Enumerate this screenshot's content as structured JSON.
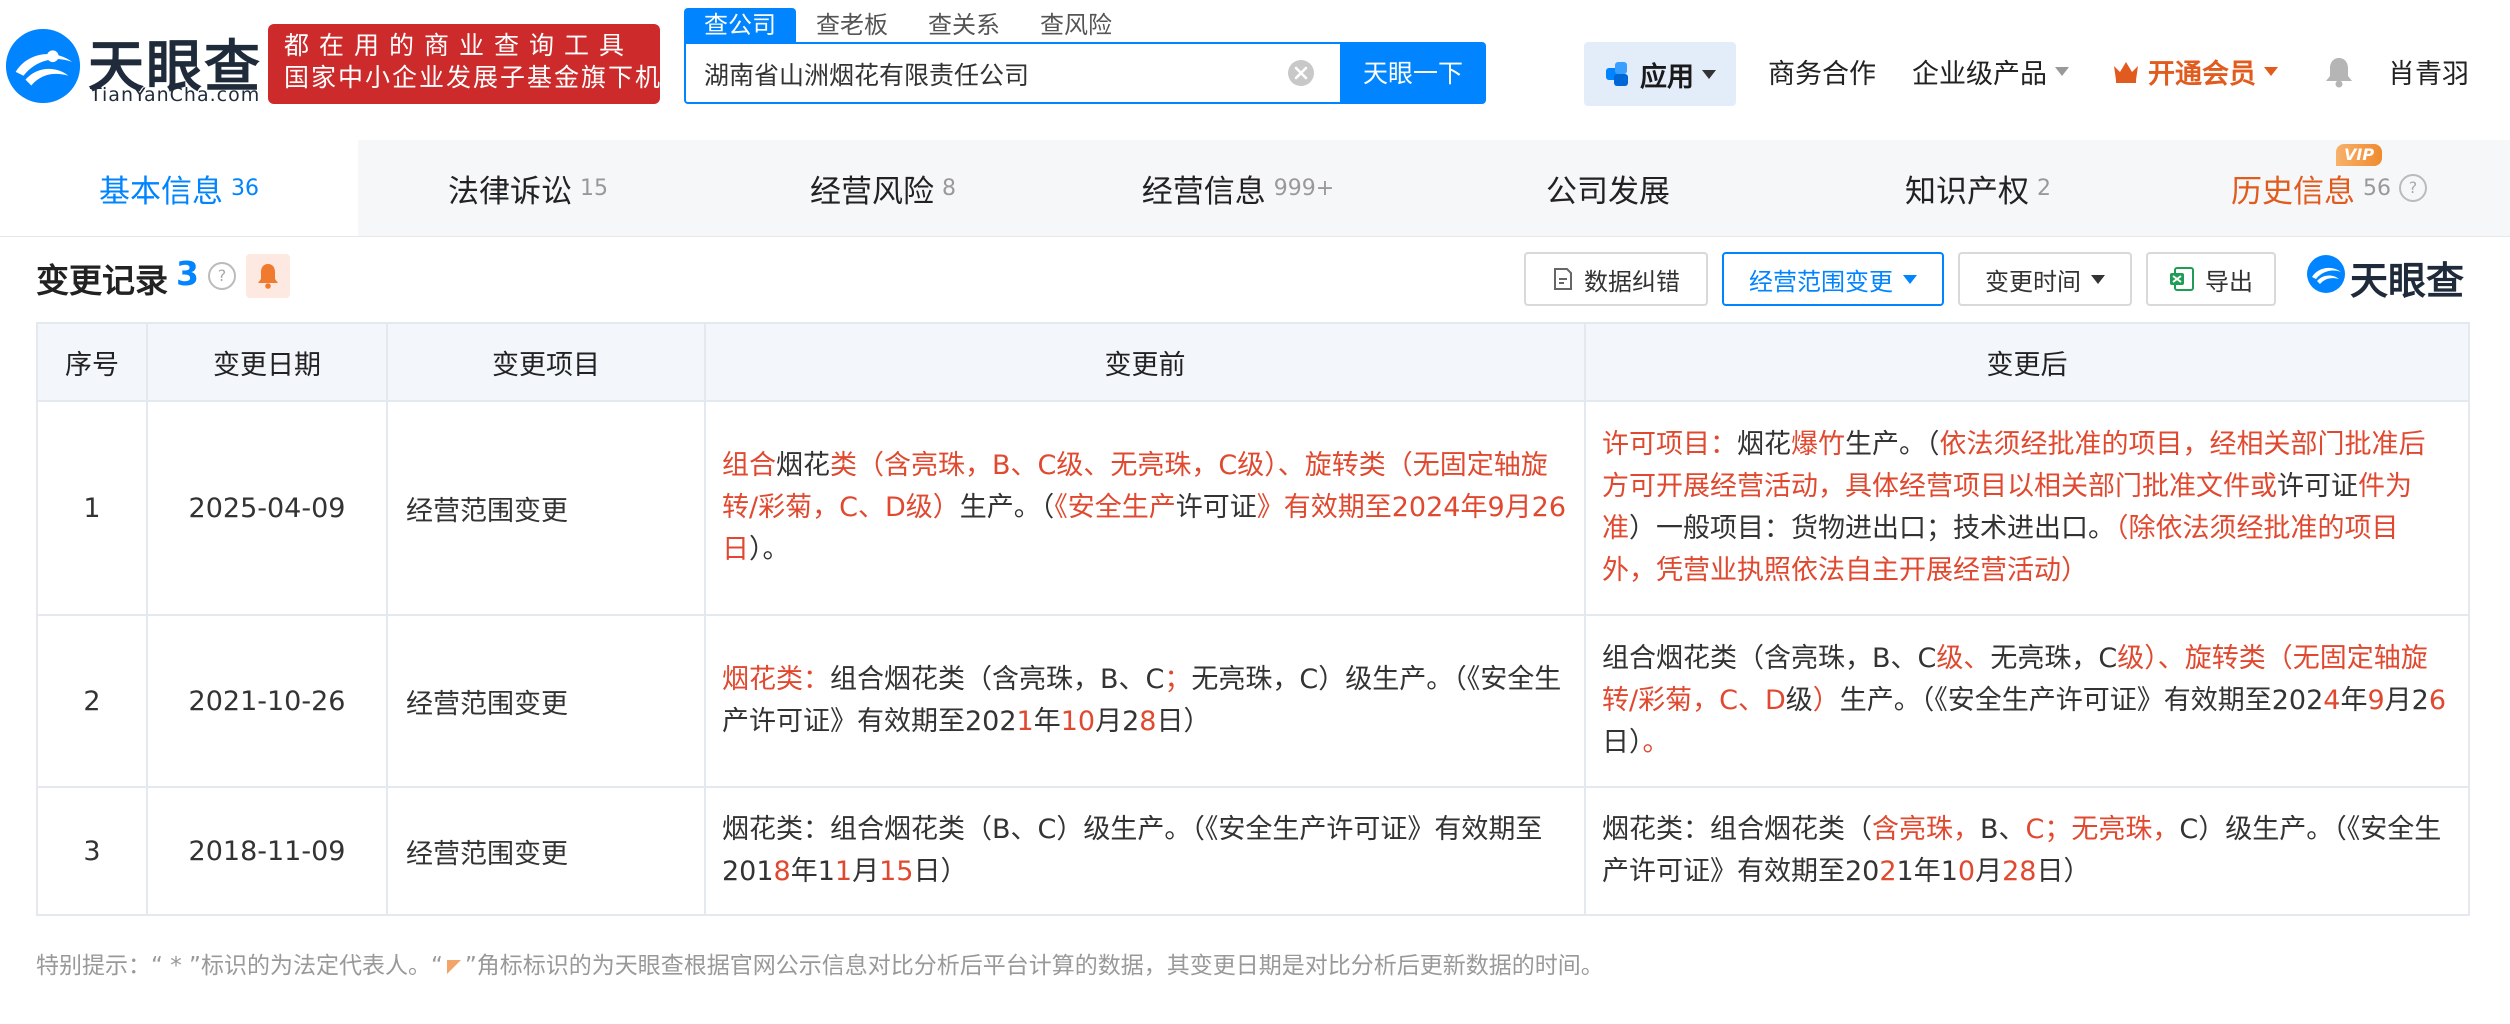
{
  "brand": {
    "name": "天眼查",
    "domain": "TianYanCha.com",
    "slogan_line1": "都在用的商业查询工具",
    "slogan_line2": "国家中小企业发展子基金旗下机构"
  },
  "search": {
    "tabs": [
      "查公司",
      "查老板",
      "查关系",
      "查风险"
    ],
    "value": "湖南省山洲烟花有限责任公司",
    "button": "天眼一下"
  },
  "nav": {
    "apps": "应用",
    "business": "商务合作",
    "enterprise": "企业级产品",
    "vip": "开通会员",
    "user": "肖青羽"
  },
  "tabs": [
    {
      "label": "基本信息",
      "count": "36"
    },
    {
      "label": "法律诉讼",
      "count": "15"
    },
    {
      "label": "经营风险",
      "count": "8"
    },
    {
      "label": "经营信息",
      "count": "999+"
    },
    {
      "label": "公司发展",
      "count": ""
    },
    {
      "label": "知识产权",
      "count": "2"
    },
    {
      "label": "历史信息",
      "count": "56"
    }
  ],
  "vip_badge": "VIP",
  "section": {
    "title": "变更记录",
    "count": "3",
    "btn_correct": "数据纠错",
    "btn_filter": "经营范围变更",
    "btn_time": "变更时间",
    "btn_export": "导出",
    "watermark": "天眼查"
  },
  "table": {
    "headers": [
      "序号",
      "变更日期",
      "变更项目",
      "变更前",
      "变更后"
    ],
    "rows": [
      {
        "no": "1",
        "date": "2025-04-09",
        "item": "经营范围变更",
        "before": [
          [
            "组合",
            1
          ],
          [
            "烟花",
            0
          ],
          [
            "类（含亮珠，B、C级、无亮珠，C级）、旋转类（无固定轴旋转/彩菊，C、D级）",
            1
          ],
          [
            "生产。（",
            0
          ],
          [
            "《安全生产",
            1
          ],
          [
            "许可证",
            0
          ],
          [
            "》有效期至2024年9月26日",
            1
          ],
          [
            "）。",
            0
          ]
        ],
        "after": [
          [
            "许可项目：",
            1
          ],
          [
            "烟花",
            0
          ],
          [
            "爆竹",
            1
          ],
          [
            "生产。（",
            0
          ],
          [
            "依法须经批准的项目，经相关部门批准后方可开展经营活动，具体经营项目以相关部门批准文件或",
            1
          ],
          [
            "许可证",
            0
          ],
          [
            "件为准",
            1
          ],
          [
            "）一般项目：货物进出口；技术进出口。",
            0
          ],
          [
            "（除依法须经批准的项目外，凭营业执照依法自主开展经营活动）",
            1
          ]
        ]
      },
      {
        "no": "2",
        "date": "2021-10-26",
        "item": "经营范围变更",
        "before": [
          [
            "烟花类：",
            1
          ],
          [
            "组合烟花类（含亮珠，B、C",
            0
          ],
          [
            "；",
            1
          ],
          [
            "无亮珠，C）级生产。（《安全生产许可证》有效期至202",
            0
          ],
          [
            "1",
            1
          ],
          [
            "年",
            0
          ],
          [
            "10",
            1
          ],
          [
            "月2",
            0
          ],
          [
            "8",
            1
          ],
          [
            "日）",
            0
          ]
        ],
        "after": [
          [
            "组合烟花类（含亮珠，B、C",
            0
          ],
          [
            "级、",
            1
          ],
          [
            "无亮珠，C",
            0
          ],
          [
            "级）、旋转类（无固定轴旋转/彩菊，C、D",
            1
          ],
          [
            "级",
            0
          ],
          [
            "）",
            1
          ],
          [
            "生产。（《安全生产许可证》有效期至202",
            0
          ],
          [
            "4",
            1
          ],
          [
            "年",
            0
          ],
          [
            "9",
            1
          ],
          [
            "月2",
            0
          ],
          [
            "6",
            1
          ],
          [
            "日）",
            0
          ],
          [
            "。",
            1
          ]
        ]
      },
      {
        "no": "3",
        "date": "2018-11-09",
        "item": "经营范围变更",
        "before": [
          [
            "烟花类：组合烟花类（B、C）级生产。（《安全生产许可证》有效期至201",
            0
          ],
          [
            "8",
            1
          ],
          [
            "年1",
            0
          ],
          [
            "1",
            1
          ],
          [
            "月",
            0
          ],
          [
            "15",
            1
          ],
          [
            "日）",
            0
          ]
        ],
        "after": [
          [
            "烟花类：组合烟花类（",
            0
          ],
          [
            "含亮珠，",
            1
          ],
          [
            "B、",
            0
          ],
          [
            "C；无亮珠，",
            1
          ],
          [
            "C）级生产。（《安全生产许可证》有效期至20",
            0
          ],
          [
            "2",
            1
          ],
          [
            "1年1",
            0
          ],
          [
            "0",
            1
          ],
          [
            "月",
            0
          ],
          [
            "28",
            1
          ],
          [
            "日）",
            0
          ]
        ]
      }
    ]
  },
  "footnote": {
    "part1": "特别提示：“ * ”标识的为法定代表人。“",
    "part2": "”角标标识的为天眼查根据官网公示信息对比分析后平台计算的数据，其变更日期是对比分析后更新数据的时间。"
  }
}
